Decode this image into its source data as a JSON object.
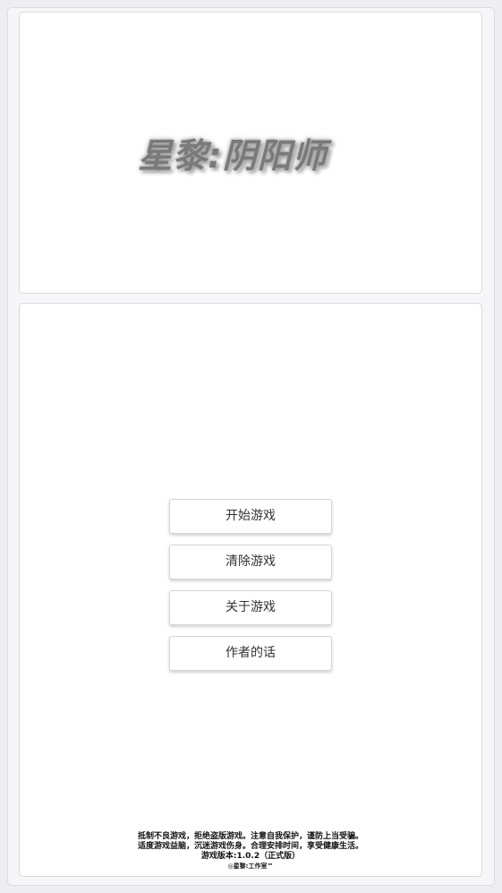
{
  "title": {
    "text": "星黎:阴阳师"
  },
  "menu": {
    "start_label": "开始游戏",
    "clear_label": "清除游戏",
    "about_label": "关于游戏",
    "author_label": "作者的话"
  },
  "footer": {
    "notice_line1": "抵制不良游戏，拒绝盗版游戏。注意自我保护，谨防上当受骗。",
    "notice_line2": "适度游戏益脑，沉迷游戏伤身。合理安排时间，享受健康生活。",
    "version": "游戏版本:1.0.2（正式版）",
    "copyright": "◎星黎:工作室™"
  }
}
